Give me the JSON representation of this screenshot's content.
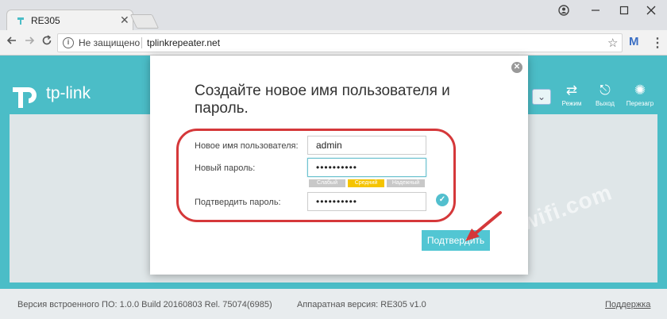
{
  "browser": {
    "tab_title": "RE305",
    "tab_close": "✕",
    "not_secure": "Не защищено",
    "url": "tplinkrepeater.net",
    "ext_label": "M"
  },
  "header": {
    "logo_text": "tp-link",
    "actions": [
      {
        "label": "Режим"
      },
      {
        "label": "Выход"
      },
      {
        "label": "Перезагр"
      }
    ]
  },
  "footer": {
    "firmware": "Версия встроенного ПО: 1.0.0 Build 20160803 Rel. 75074(6985)",
    "hardware": "Аппаратная версия: RE305 v1.0",
    "support": "Поддержка"
  },
  "watermark": "help-wifi.com",
  "modal": {
    "title": "Создайте новое имя пользователя и пароль.",
    "username_label": "Новое имя пользователя:",
    "username_value": "admin",
    "password_label": "Новый пароль:",
    "password_value": "••••••••••",
    "confirm_label": "Подтвердить пароль:",
    "confirm_value": "••••••••••",
    "strength": {
      "weak": "Слабый",
      "medium": "Средний",
      "strong": "Надежный"
    },
    "submit_label": "Подтвердить"
  },
  "colors": {
    "accent": "#4bbdc7",
    "button": "#52c6d3",
    "annotation": "#d5383a",
    "strength_medium": "#f5c400",
    "strength_inactive": "#c8c8c8"
  }
}
